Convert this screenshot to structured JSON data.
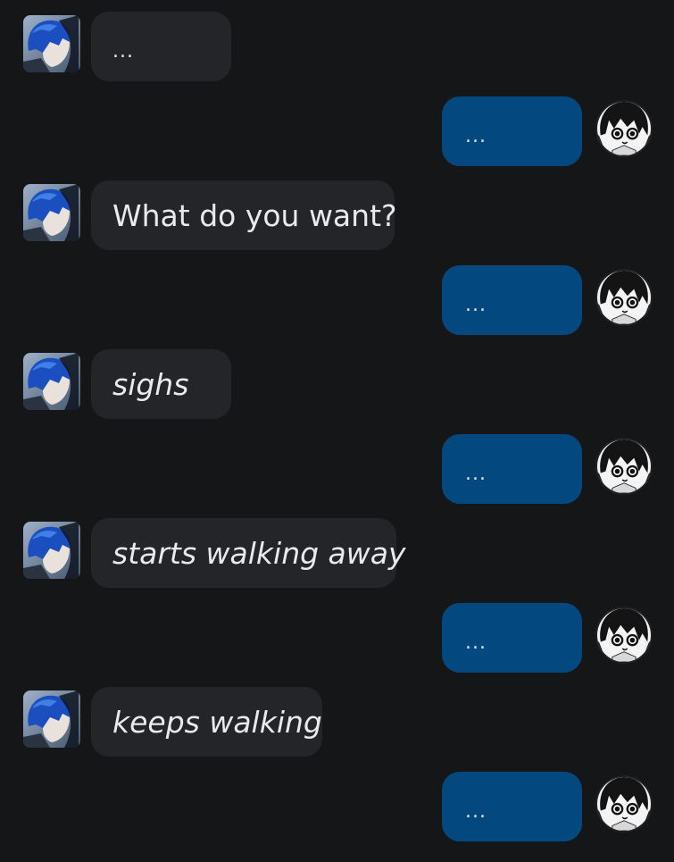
{
  "theme": {
    "background": "#151618",
    "incoming_bubble": "#232529",
    "outgoing_bubble": "#03497f",
    "text": "#e9eaec"
  },
  "messages": [
    {
      "sender": "other",
      "text": "...",
      "style": "ellipsis",
      "avatar": "blue-haired-character-avatar"
    },
    {
      "sender": "me",
      "text": "...",
      "style": "ellipsis",
      "avatar": "manga-girl-avatar"
    },
    {
      "sender": "other",
      "text": "What do you want?",
      "style": "normal",
      "avatar": "blue-haired-character-avatar"
    },
    {
      "sender": "me",
      "text": "...",
      "style": "ellipsis",
      "avatar": "manga-girl-avatar"
    },
    {
      "sender": "other",
      "text": "sighs",
      "style": "italic",
      "avatar": "blue-haired-character-avatar"
    },
    {
      "sender": "me",
      "text": "...",
      "style": "ellipsis",
      "avatar": "manga-girl-avatar"
    },
    {
      "sender": "other",
      "text": "starts walking away",
      "style": "italic",
      "avatar": "blue-haired-character-avatar"
    },
    {
      "sender": "me",
      "text": "...",
      "style": "ellipsis",
      "avatar": "manga-girl-avatar"
    },
    {
      "sender": "other",
      "text": "keeps walking",
      "style": "italic",
      "avatar": "blue-haired-character-avatar"
    },
    {
      "sender": "me",
      "text": "...",
      "style": "ellipsis",
      "avatar": "manga-girl-avatar"
    }
  ]
}
